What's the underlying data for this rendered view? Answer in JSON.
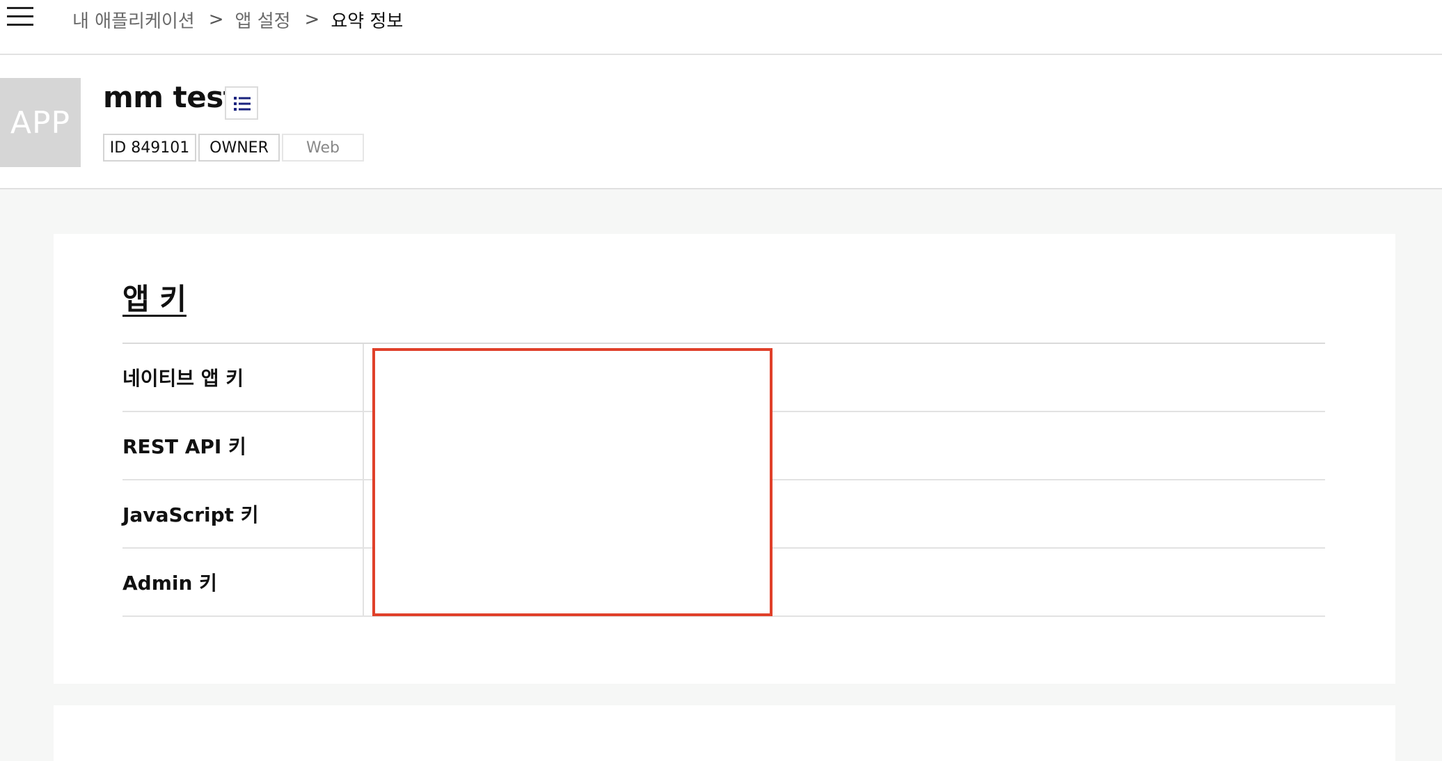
{
  "breadcrumb": {
    "items": [
      "내 애플리케이션",
      "앱 설정",
      "요약 정보"
    ],
    "separator": ">"
  },
  "app": {
    "thumb_text": "APP",
    "name": "mm test",
    "tags": {
      "id": "ID 849101",
      "role": "OWNER",
      "platform": "Web"
    }
  },
  "app_keys": {
    "title": "앱 키",
    "rows": [
      {
        "label": "네이티브 앱 키"
      },
      {
        "label": "REST API 키"
      },
      {
        "label": "JavaScript 키"
      },
      {
        "label": "Admin 키"
      }
    ]
  },
  "colors": {
    "redaction_border": "#e0402a",
    "list_icon": "#1a237e"
  },
  "icons": {
    "menu": "hamburger-menu-icon",
    "list": "list-icon"
  }
}
